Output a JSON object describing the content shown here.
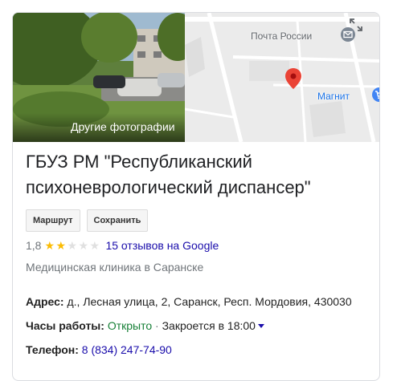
{
  "media": {
    "photo_label": "Другие фотографии",
    "map_labels": {
      "post": "Почта России",
      "magnit": "Магнит"
    }
  },
  "place": {
    "name": "ГБУЗ РМ \"Республиканский психоневрологический диспансер\"",
    "category": "Медицинская клиника в Саранске"
  },
  "actions": {
    "route_label": "Маршрут",
    "save_label": "Сохранить"
  },
  "rating": {
    "value": "1,8",
    "stars": 1.8,
    "max_stars": 5,
    "reviews_text": "15 отзывов на Google"
  },
  "details": {
    "address_label": "Адрес:",
    "address_value": "д., Лесная улица, 2, Саранск, Респ. Мордовия, 430030",
    "hours_label": "Часы работы:",
    "hours_status": "Открыто",
    "hours_separator": "·",
    "hours_close": "Закроется в 18:00",
    "phone_label": "Телефон:",
    "phone_value": "8 (834) 247-74-90"
  },
  "colors": {
    "star_on": "#fbbc04",
    "link": "#1a0dab",
    "open": "#188038",
    "pin": "#ea4335"
  }
}
